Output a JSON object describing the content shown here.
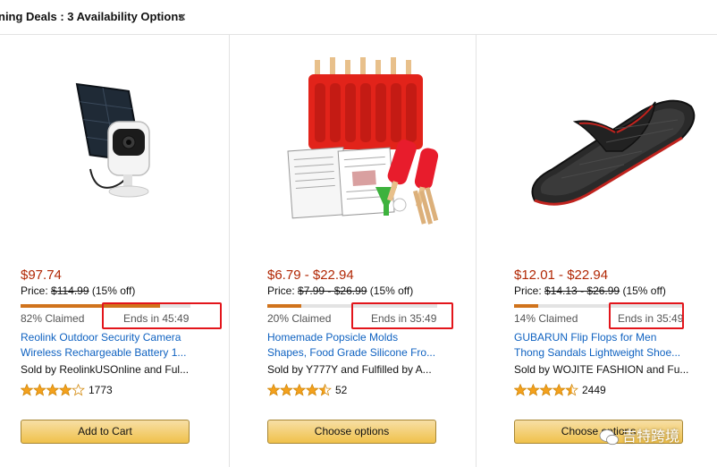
{
  "filter": {
    "label": "ning Deals : 3 Availability Options",
    "close_glyph": "×"
  },
  "colors": {
    "deal_price": "#b12704",
    "link": "#0f62c1",
    "progress_fill": "#d0731c",
    "highlight_box": "#e3151b",
    "button": "#f0c14b",
    "star": "#f4a11c"
  },
  "products": [
    {
      "image_icon": "security-camera-with-solar-panel",
      "deal_price": "$97.74",
      "price_label": "Price:",
      "list_price": "$114.99",
      "discount": "(15% off)",
      "claimed_percent": 82,
      "claimed_text": "82% Claimed",
      "ends_text": "Ends in 45:49",
      "title_line1": "Reolink Outdoor Security Camera",
      "title_line2": "Wireless Rechargeable Battery 1...",
      "seller": "Sold by ReolinkUSOnline and Ful...",
      "stars": 4,
      "rating_count": "1773",
      "button_label": "Add to Cart"
    },
    {
      "image_icon": "popsicle-molds-kit",
      "deal_price": "$6.79 - $22.94",
      "price_label": "Price:",
      "list_price": "$7.99 - $26.99",
      "discount": "(15% off)",
      "claimed_percent": 20,
      "claimed_text": "20% Claimed",
      "ends_text": "Ends in 35:49",
      "title_line1": "Homemade Popsicle Molds",
      "title_line2": "Shapes, Food Grade Silicone Fro...",
      "seller": "Sold by Y777Y and Fulfilled by A...",
      "stars": 4.5,
      "rating_count": "52",
      "button_label": "Choose options"
    },
    {
      "image_icon": "flip-flop-sandal",
      "deal_price": "$12.01 - $22.94",
      "price_label": "Price:",
      "list_price": "$14.13 - $26.99",
      "discount": "(15% off)",
      "claimed_percent": 14,
      "claimed_text": "14% Claimed",
      "ends_text": "Ends in 35:49",
      "title_line1": "GUBARUN Flip Flops for Men",
      "title_line2": "Thong Sandals Lightweight Shoe...",
      "seller": "Sold by WOJITE FASHION and Fu...",
      "stars": 4.5,
      "rating_count": "2449",
      "button_label": "Choose options"
    }
  ],
  "watermark": {
    "text": "吉特跨境"
  }
}
